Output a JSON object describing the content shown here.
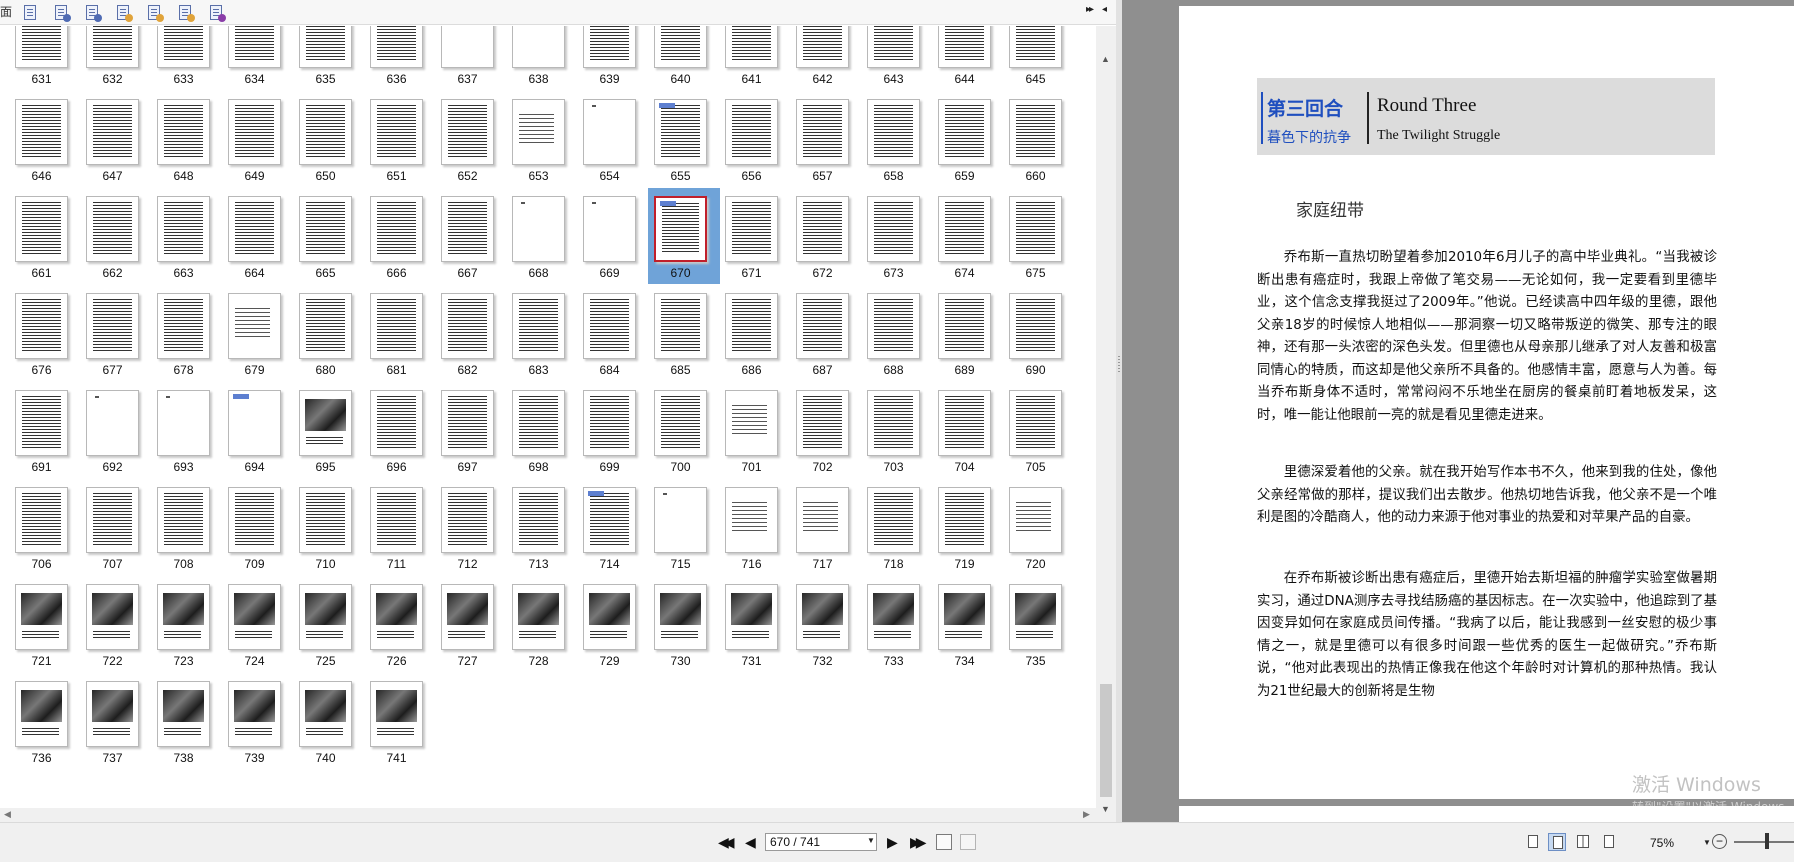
{
  "left_panel": {
    "toolbar_cut_label": "面",
    "toolbar_icons": [
      {
        "name": "thumb-page-icon-1",
        "badge_color": ""
      },
      {
        "name": "thumb-insert-page-icon",
        "badge_color": "#4f6bb4"
      },
      {
        "name": "thumb-extract-page-icon",
        "badge_color": "#4f6bb4"
      },
      {
        "name": "thumb-replace-page-icon",
        "badge_color": "#e0a33a"
      },
      {
        "name": "thumb-delete-page-icon",
        "badge_color": "#e0a33a"
      },
      {
        "name": "thumb-rotate-page-icon",
        "badge_color": "#e0a33a"
      },
      {
        "name": "thumb-page-properties-icon",
        "badge_color": "#8a3da8"
      }
    ],
    "expand_glyph": "▸▸",
    "collapse_glyph": "◂",
    "thumbnails": {
      "selected_page": 670,
      "first_page": 631,
      "last_page": 741,
      "per_row": 15,
      "labels": [
        "631",
        "632",
        "633",
        "634",
        "635",
        "636",
        "637",
        "638",
        "639",
        "640",
        "641",
        "642",
        "643",
        "644",
        "645",
        "646",
        "647",
        "648",
        "649",
        "650",
        "651",
        "652",
        "653",
        "654",
        "655",
        "656",
        "657",
        "658",
        "659",
        "660",
        "661",
        "662",
        "663",
        "664",
        "665",
        "666",
        "667",
        "668",
        "669",
        "670",
        "671",
        "672",
        "673",
        "674",
        "675",
        "676",
        "677",
        "678",
        "679",
        "680",
        "681",
        "682",
        "683",
        "684",
        "685",
        "686",
        "687",
        "688",
        "689",
        "690",
        "691",
        "692",
        "693",
        "694",
        "695",
        "696",
        "697",
        "698",
        "699",
        "700",
        "701",
        "702",
        "703",
        "704",
        "705",
        "706",
        "707",
        "708",
        "709",
        "710",
        "711",
        "712",
        "713",
        "714",
        "715",
        "716",
        "717",
        "718",
        "719",
        "720",
        "721",
        "722",
        "723",
        "724",
        "725",
        "726",
        "727",
        "728",
        "729",
        "730",
        "731",
        "732",
        "733",
        "734",
        "735",
        "736",
        "737",
        "738",
        "739",
        "740",
        "741"
      ],
      "styles": {
        "631": "text",
        "632": "text",
        "633": "text",
        "634": "text",
        "635": "text",
        "636": "text",
        "637": "blank",
        "638": "blank",
        "639": "text header",
        "640": "text",
        "641": "text",
        "642": "text",
        "643": "text",
        "644": "text",
        "645": "text",
        "646": "text",
        "647": "text",
        "648": "text",
        "649": "text",
        "650": "text",
        "651": "text",
        "652": "text",
        "653": "sparse",
        "654": "blank",
        "655": "text header",
        "656": "text",
        "657": "text",
        "658": "text",
        "659": "text",
        "660": "text",
        "661": "text",
        "662": "text",
        "663": "text",
        "664": "text",
        "665": "text",
        "666": "text",
        "667": "text",
        "668": "blank",
        "669": "blank",
        "670": "text header",
        "671": "text",
        "672": "text",
        "673": "text",
        "674": "text",
        "675": "text",
        "676": "text",
        "677": "text",
        "678": "text",
        "679": "sparse",
        "680": "text",
        "681": "text",
        "682": "text",
        "683": "text",
        "684": "text",
        "685": "text",
        "686": "text",
        "687": "text",
        "688": "text",
        "689": "text",
        "690": "text",
        "691": "text",
        "692": "blank",
        "693": "blank",
        "694": "blank header",
        "695": "photo",
        "696": "text",
        "697": "text",
        "698": "text",
        "699": "text",
        "700": "text",
        "701": "sparse",
        "702": "text",
        "703": "text",
        "704": "text",
        "705": "text",
        "706": "text",
        "707": "text",
        "708": "text",
        "709": "text",
        "710": "text",
        "711": "text",
        "712": "text",
        "713": "text",
        "714": "text header",
        "715": "blank",
        "716": "sparse",
        "717": "sparse",
        "718": "text",
        "719": "text",
        "720": "sparse",
        "721": "photo",
        "722": "photo",
        "723": "photo",
        "724": "photo",
        "725": "photo",
        "726": "photo",
        "727": "photo",
        "728": "photo",
        "729": "photo",
        "730": "photo",
        "731": "photo",
        "732": "photo",
        "733": "photo",
        "734": "photo",
        "735": "photo",
        "736": "photo",
        "737": "photo",
        "738": "photo",
        "739": "photo",
        "740": "photo",
        "741": "photo"
      }
    }
  },
  "document": {
    "chapter_cn": "第三回合",
    "chapter_cn_sub": "暮色下的抗争",
    "chapter_en": "Round Three",
    "chapter_en_sub": "The Twilight Struggle",
    "section_title": "家庭纽带",
    "paragraphs": [
      "乔布斯一直热切盼望着参加2010年6月儿子的高中毕业典礼。“当我被诊断出患有癌症时，我跟上帝做了笔交易——无论如何，我一定要看到里德毕业，这个信念支撑我挺过了2009年。”他说。已经读高中四年级的里德，跟他父亲18岁的时候惊人地相似——那洞察一切又略带叛逆的微笑、那专注的眼神，还有那一头浓密的深色头发。但里德也从母亲那儿继承了对人友善和极富同情心的特质，而这却是他父亲所不具备的。他感情丰富，愿意与人为善。每当乔布斯身体不适时，常常闷闷不乐地坐在厨房的餐桌前盯着地板发呆，这时，唯一能让他眼前一亮的就是看见里德走进来。",
      "里德深爱着他的父亲。就在我开始写作本书不久，他来到我的住处，像他父亲经常做的那样，提议我们出去散步。他热切地告诉我，他父亲不是一个唯利是图的冷酷商人，他的动力来源于他对事业的热爱和对苹果产品的自豪。",
      "在乔布斯被诊断出患有癌症后，里德开始去斯坦福的肿瘤学实验室做暑期实习，通过DNA测序去寻找结肠癌的基因标志。在一次实验中，他追踪到了基因变异如何在家庭成员间传播。“我病了以后，能让我感到一丝安慰的极少事情之一，就是里德可以有很多时间跟一些优秀的医生一起做研究。”乔布斯说，“他对此表现出的热情正像我在他这个年龄时对计算机的那种热情。我认为21世纪最大的创新将是生物"
    ],
    "watermark": "激活 Windows",
    "watermark_sub": "转到\"设置\"以激活 Windows。"
  },
  "statusbar": {
    "nav_first": "◀◀",
    "nav_prev": "◀",
    "nav_next": "▶",
    "nav_last": "▶▶",
    "page_value": "670 / 741",
    "dropdown_glyph": "▼",
    "zoom_label": "75%",
    "zoom_dropdown": "▼",
    "zoom_out": "−"
  }
}
